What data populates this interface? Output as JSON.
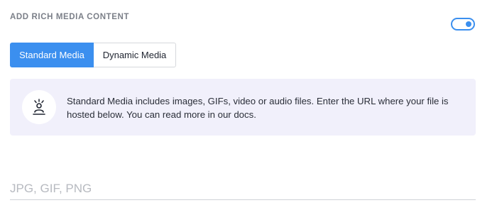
{
  "section": {
    "title": "ADD RICH MEDIA CONTENT",
    "toggle_on": true
  },
  "tabs": [
    {
      "label": "Standard Media",
      "active": true
    },
    {
      "label": "Dynamic Media",
      "active": false
    }
  ],
  "info": {
    "icon": "person-spark-icon",
    "text": "Standard Media includes images, GIFs, video or audio files. Enter the URL where your file is hosted below. You can read more in our docs."
  },
  "url_field": {
    "value": "",
    "placeholder": "JPG, GIF, PNG"
  },
  "colors": {
    "accent": "#3b8fef",
    "info_background": "#f1f0fb",
    "section_title": "#7b7f88"
  }
}
